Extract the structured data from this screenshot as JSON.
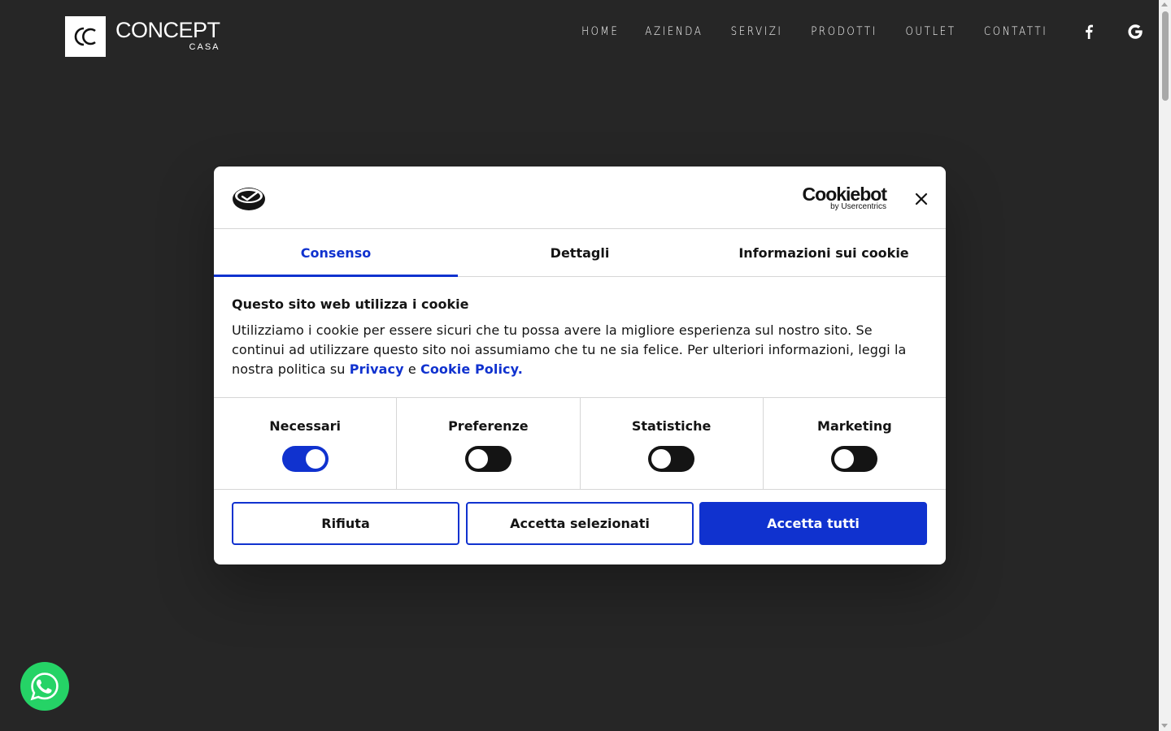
{
  "header": {
    "logo_main": "CONCEPT",
    "logo_sub": "CASA",
    "nav": [
      "HOME",
      "AZIENDA",
      "SERVIZI",
      "PRODOTTI",
      "OUTLET",
      "CONTATTI"
    ],
    "icons": [
      "facebook-icon",
      "google-icon"
    ]
  },
  "dialog": {
    "brand": "Cookiebot",
    "brand_sub": "by Usercentrics",
    "tabs": [
      "Consenso",
      "Dettagli",
      "Informazioni sui cookie"
    ],
    "active_tab": "Consenso",
    "title": "Questo sito web utilizza i cookie",
    "text_before": "Utilizziamo i cookie per essere sicuri che tu possa avere la migliore esperienza sul nostro sito. Se continui ad utilizzare questo sito noi assumiamo che tu ne sia felice. Per ulteriori informazioni, leggi la nostra politica su ",
    "privacy_link": "Privacy",
    "and_text": " e ",
    "cookie_policy_link": "Cookie Policy.",
    "toggles": [
      {
        "label": "Necessari",
        "on": true
      },
      {
        "label": "Preferenze",
        "on": false
      },
      {
        "label": "Statistiche",
        "on": false
      },
      {
        "label": "Marketing",
        "on": false
      }
    ],
    "buttons": {
      "reject": "Rifiuta",
      "accept_selected": "Accetta selezionati",
      "accept_all": "Accetta tutti"
    }
  },
  "colors": {
    "background": "#262626",
    "accent": "#1032cf",
    "whatsapp": "#25d366"
  }
}
